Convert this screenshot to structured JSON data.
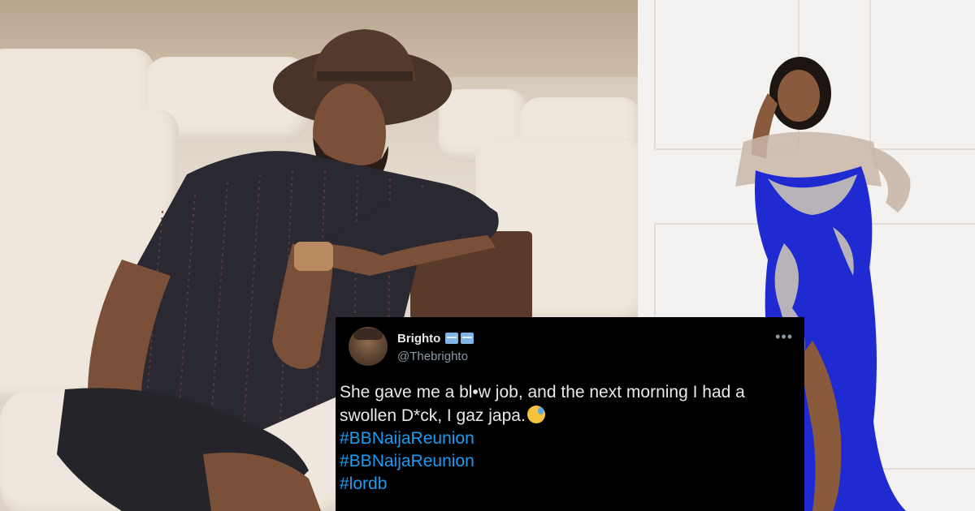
{
  "tweet": {
    "author_name": "Brighto",
    "author_handle": "@Thebrighto",
    "badge_icons": [
      "emoji-badge-icon",
      "emoji-badge-icon"
    ],
    "more_label": "•••",
    "text": "She gave me a bl•w job, and the next morning I had a swollen D*ck, I gaz japa.",
    "emoji_icon": "downcast-sweat-face-icon",
    "hashtags": [
      "#BBNaijaReunion",
      "#BBNaijaReunion",
      "#lordb"
    ],
    "colors": {
      "background": "#000000",
      "text": "#e7e9ea",
      "handle": "#8b98a5",
      "link": "#1d9bf0"
    }
  },
  "photos": {
    "left": "man-in-hat-on-sofa-photo",
    "right": "woman-in-blue-gown-photo"
  }
}
